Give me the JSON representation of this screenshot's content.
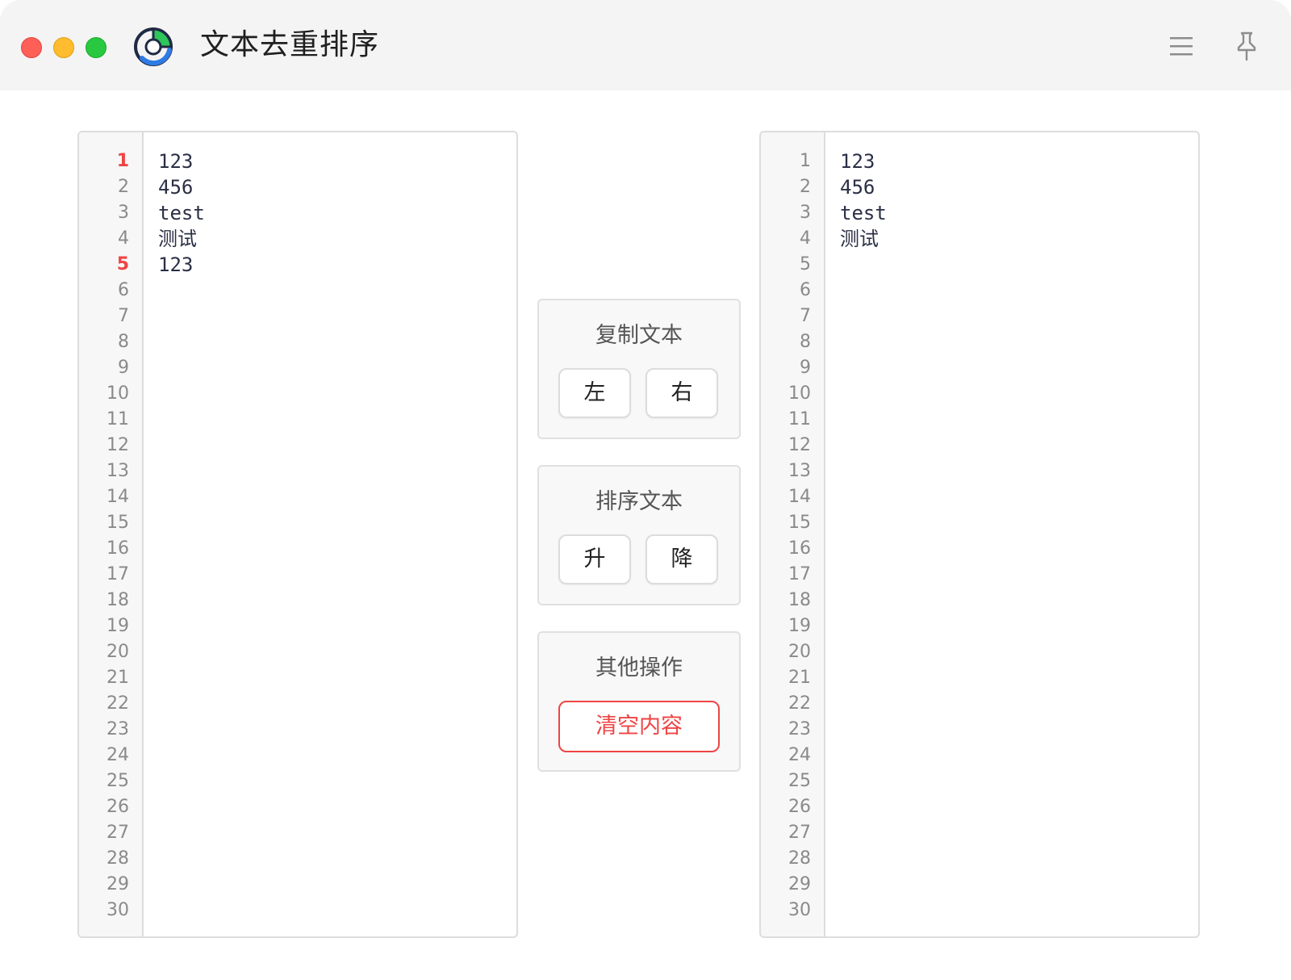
{
  "window": {
    "title": "文本去重排序",
    "accent_color": "#ef4444",
    "icons": [
      "app-logo-icon",
      "menu-icon",
      "pin-icon"
    ]
  },
  "left_editor": {
    "lines": [
      "123",
      "456",
      "test",
      "测试",
      "123"
    ],
    "line_numbers": [
      "1",
      "2",
      "3",
      "4",
      "5",
      "6",
      "7",
      "8",
      "9",
      "10",
      "11",
      "12",
      "13",
      "14",
      "15",
      "16",
      "17",
      "18",
      "19",
      "20",
      "21",
      "22",
      "23",
      "24",
      "25",
      "26",
      "27",
      "28",
      "29",
      "30"
    ],
    "highlighted_line_numbers": [
      1,
      5
    ]
  },
  "right_editor": {
    "lines": [
      "123",
      "456",
      "test",
      "测试"
    ],
    "line_numbers": [
      "1",
      "2",
      "3",
      "4",
      "5",
      "6",
      "7",
      "8",
      "9",
      "10",
      "11",
      "12",
      "13",
      "14",
      "15",
      "16",
      "17",
      "18",
      "19",
      "20",
      "21",
      "22",
      "23",
      "24",
      "25",
      "26",
      "27",
      "28",
      "29",
      "30"
    ]
  },
  "copy_group": {
    "title": "复制文本",
    "left_label": "左",
    "right_label": "右"
  },
  "sort_group": {
    "title": "排序文本",
    "asc_label": "升",
    "desc_label": "降"
  },
  "other_group": {
    "title": "其他操作",
    "clear_label": "清空内容"
  }
}
